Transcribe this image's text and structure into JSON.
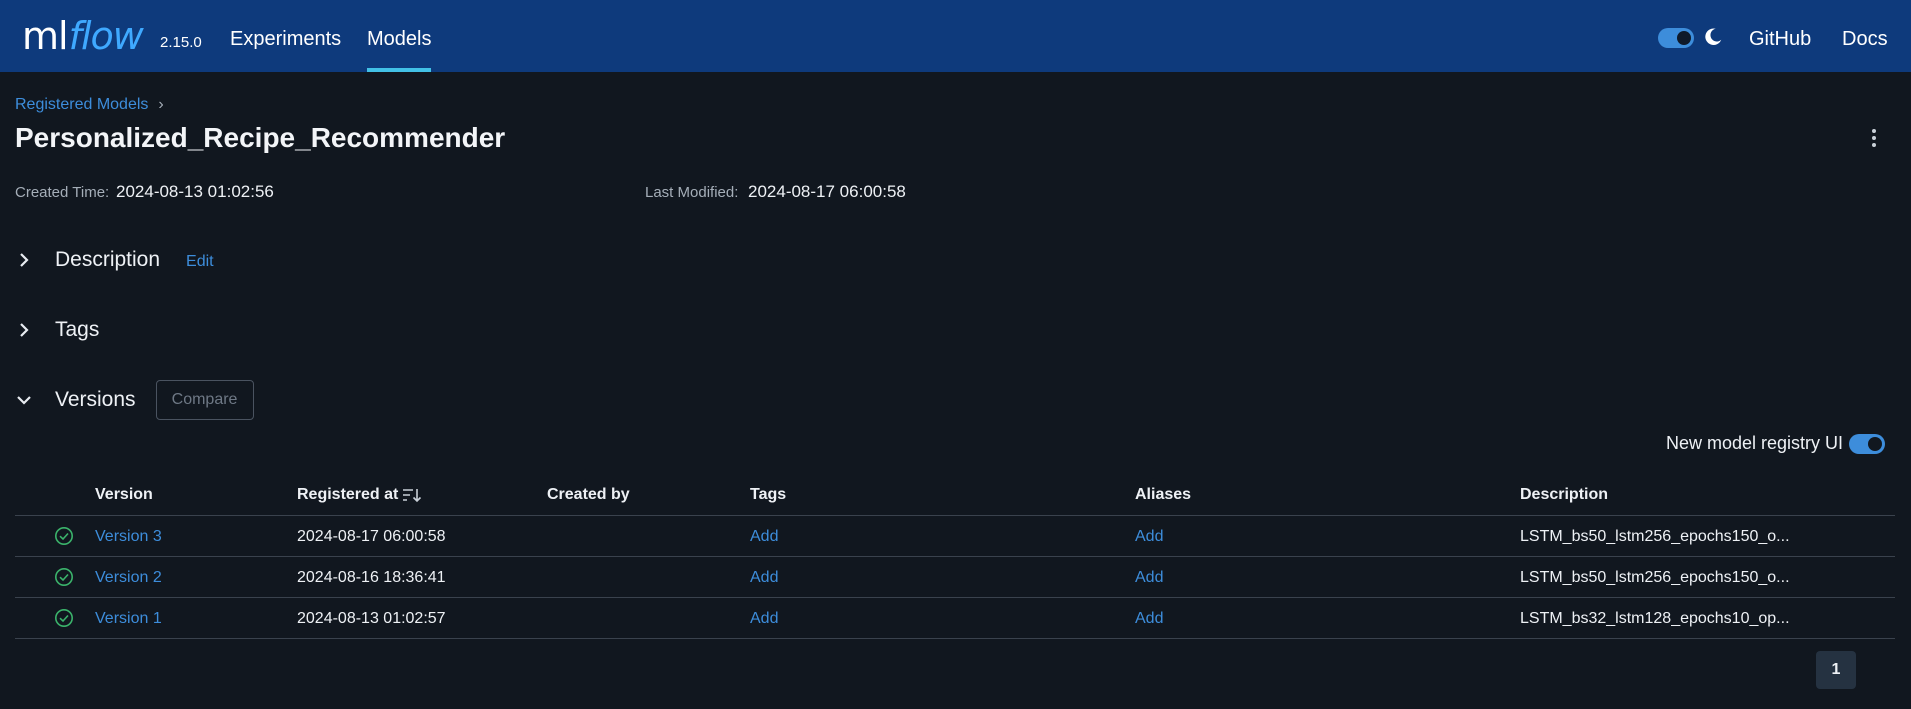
{
  "header": {
    "logo_ml": "ml",
    "logo_flow": "flow",
    "version": "2.15.0",
    "nav": [
      {
        "label": "Experiments",
        "active": false
      },
      {
        "label": "Models",
        "active": true
      }
    ],
    "links": {
      "github": "GitHub",
      "docs": "Docs"
    },
    "theme_dark_mode": true
  },
  "breadcrumb": {
    "parent": "Registered Models",
    "separator": "›"
  },
  "model": {
    "name": "Personalized_Recipe_Recommender",
    "created_label": "Created Time:",
    "created_value": "2024-08-13 01:02:56",
    "modified_label": "Last Modified:",
    "modified_value": "2024-08-17 06:00:58"
  },
  "sections": {
    "description": {
      "title": "Description",
      "edit_label": "Edit",
      "expanded": false
    },
    "tags": {
      "title": "Tags",
      "expanded": false
    },
    "versions": {
      "title": "Versions",
      "compare_label": "Compare",
      "expanded": true
    }
  },
  "registry_toggle": {
    "label": "New model registry UI",
    "enabled": true
  },
  "table": {
    "headers": {
      "version": "Version",
      "registered_at": "Registered at",
      "created_by": "Created by",
      "tags": "Tags",
      "aliases": "Aliases",
      "description": "Description"
    },
    "rows": [
      {
        "version": "Version 3",
        "registered_at": "2024-08-17 06:00:58",
        "created_by": "",
        "tags": "Add",
        "aliases": "Add",
        "description": "LSTM_bs50_lstm256_epochs150_o..."
      },
      {
        "version": "Version 2",
        "registered_at": "2024-08-16 18:36:41",
        "created_by": "",
        "tags": "Add",
        "aliases": "Add",
        "description": "LSTM_bs50_lstm256_epochs150_o..."
      },
      {
        "version": "Version 1",
        "registered_at": "2024-08-13 01:02:57",
        "created_by": "",
        "tags": "Add",
        "aliases": "Add",
        "description": "LSTM_bs32_lstm128_epochs10_op..."
      }
    ]
  },
  "pagination": {
    "current_page": "1"
  },
  "colors": {
    "header_bg": "#0e3a7c",
    "page_bg": "#11171f",
    "link": "#3d8ddb",
    "status_ready": "#3bb36b",
    "nav_active_underline": "#42c1e6"
  }
}
